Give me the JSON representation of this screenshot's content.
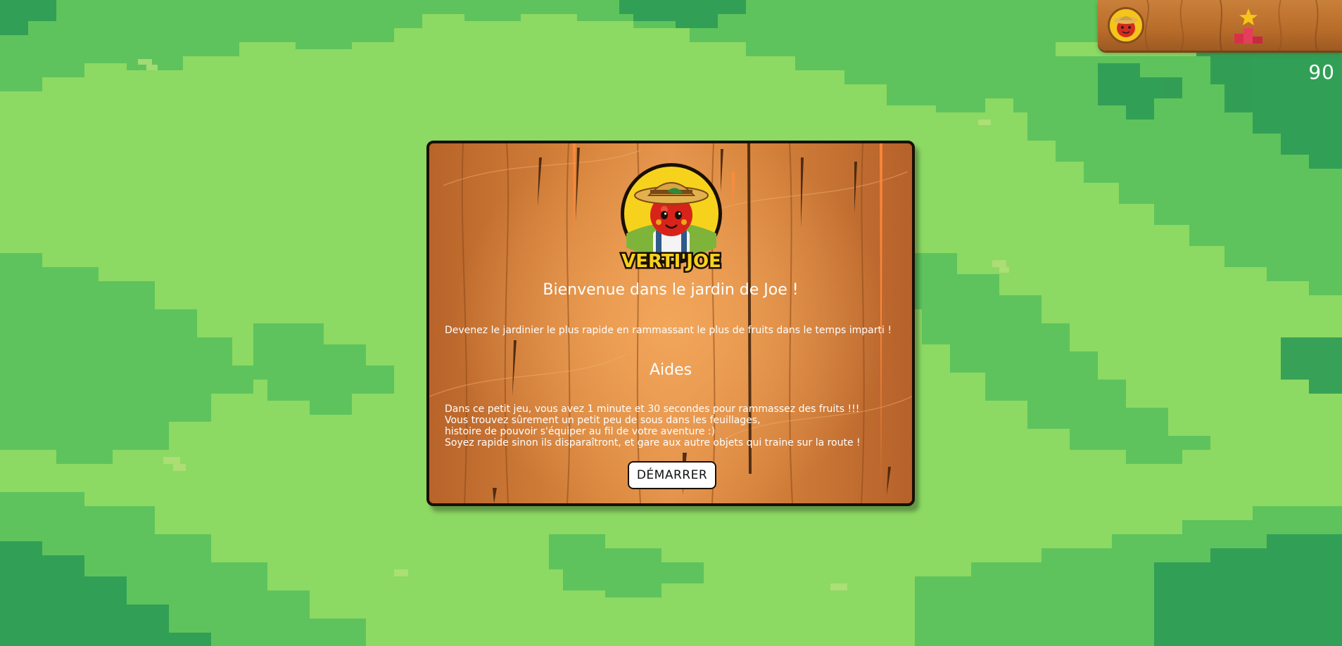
{
  "hud": {
    "avatar_icon": "tomato-farmer-avatar-icon",
    "podium_icon": "star-podium-icon",
    "timer": "90"
  },
  "modal": {
    "logo_text": "VERTI'JOE",
    "logo_icon": "tomato-farmer-logo",
    "title": "Bienvenue dans le jardin de Joe !",
    "intro": "Devenez le jardinier le plus rapide en rammassant le plus de fruits dans le temps imparti !",
    "help_title": "Aides",
    "help_lines": [
      "Dans ce petit jeu, vous avez 1 minute et 30 secondes pour rammassez des fruits !!!",
      "Vous trouvez sûrement un petit peu de sous dans les feuillages,",
      "histoire de pouvoir s'équiper au fil de votre aventure :)",
      "Soyez rapide sinon ils disparaîtront, et gare aux autre objets qui traine sur la route !"
    ],
    "start_label": "DÉMARRER"
  },
  "colors": {
    "grass_light": "#8cd964",
    "grass_mid": "#56c25a",
    "grass_dark": "#2f9a55",
    "wood": "#d9863e",
    "border": "#1a0f05"
  }
}
